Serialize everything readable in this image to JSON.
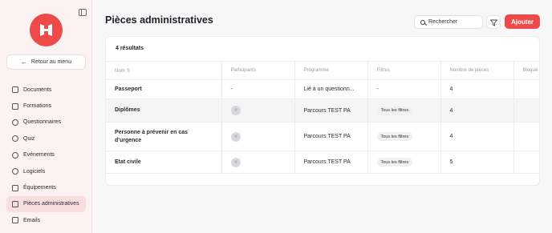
{
  "sidebar": {
    "back_label": "Retour au menu",
    "items": [
      {
        "label": "Documents",
        "icon": "document-icon"
      },
      {
        "label": "Formations",
        "icon": "book-icon"
      },
      {
        "label": "Questionnaires",
        "icon": "question-icon"
      },
      {
        "label": "Quiz",
        "icon": "chat-icon"
      },
      {
        "label": "Evénements",
        "icon": "people-icon"
      },
      {
        "label": "Logiciels",
        "icon": "mouse-icon"
      },
      {
        "label": "Équipements",
        "icon": "laptop-icon"
      },
      {
        "label": "Pièces administratives",
        "icon": "id-card-icon",
        "active": true
      },
      {
        "label": "Emails",
        "icon": "mail-icon"
      }
    ]
  },
  "header": {
    "title": "Pièces administratives",
    "search_label": "Rechercher",
    "add_label": "Ajouter"
  },
  "table": {
    "results": "4 résultats",
    "columns": [
      "Nom",
      "Participants",
      "Programme",
      "Filtres",
      "Nombre de pièces",
      "Bloqué"
    ],
    "rows": [
      {
        "name": "Passeport",
        "participants": "-",
        "programme": "Lié à un questionn...",
        "filtres": "-",
        "nombre": "4"
      },
      {
        "name": "Diplômes",
        "participants": "",
        "programme": "Parcours TEST PA",
        "filtres": "Tous les filtres",
        "nombre": "4"
      },
      {
        "name": "Personne à prévenir en cas d'urgence",
        "participants": "",
        "programme": "Parcours TEST PA",
        "filtres": "Tous les filtres",
        "nombre": "4"
      },
      {
        "name": "Etat civile",
        "participants": "",
        "programme": "Parcours TEST PA",
        "filtres": "Tous les filtres",
        "nombre": "5"
      }
    ]
  },
  "colors": {
    "accent": "#ee4a4a",
    "sidebar_bg": "#fdf2f2",
    "active_bg": "#f9dede"
  }
}
